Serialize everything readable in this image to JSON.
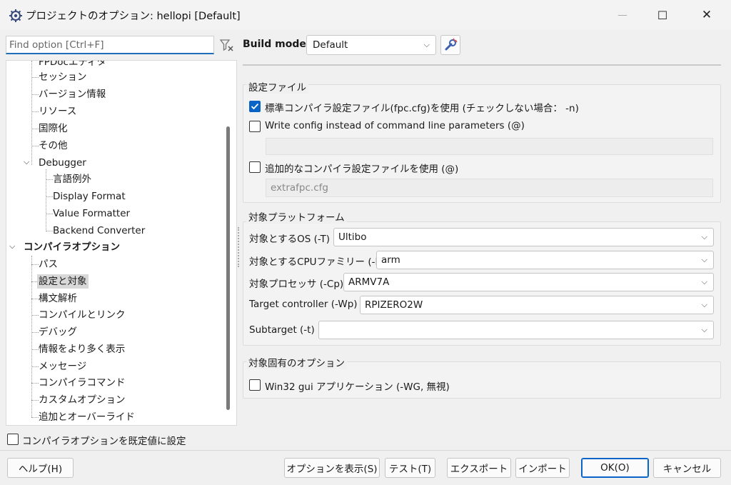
{
  "window": {
    "title": "プロジェクトのオプション: hellopi [Default]",
    "minimize": "—",
    "maximize": "☐",
    "close": "✕"
  },
  "search": {
    "placeholder": "Find option [Ctrl+F]"
  },
  "build_mode": {
    "label": "Build mode",
    "value": "Default"
  },
  "tree": {
    "items": [
      {
        "label": "FPDocエディタ"
      },
      {
        "label": "セッション"
      },
      {
        "label": "バージョン情報"
      },
      {
        "label": "リソース"
      },
      {
        "label": "国際化"
      },
      {
        "label": "その他"
      },
      {
        "label": "Debugger"
      },
      {
        "label": "言語例外"
      },
      {
        "label": "Display Format"
      },
      {
        "label": "Value Formatter"
      },
      {
        "label": "Backend Converter"
      },
      {
        "label": "コンパイラオプション"
      },
      {
        "label": "パス"
      },
      {
        "label": "設定と対象"
      },
      {
        "label": "構文解析"
      },
      {
        "label": "コンパイルとリンク"
      },
      {
        "label": "デバッグ"
      },
      {
        "label": "情報をより多く表示"
      },
      {
        "label": "メッセージ"
      },
      {
        "label": "コンパイラコマンド"
      },
      {
        "label": "カスタムオプション"
      },
      {
        "label": "追加とオーバーライド"
      }
    ],
    "expand_glyph": "⌵"
  },
  "config_files": {
    "group_label": "設定ファイル",
    "use_standard": {
      "label": "標準コンパイラ設定ファイル(fpc.cfg)を使用 (チェックしない場合： -n)",
      "checked": true
    },
    "write_config": {
      "label": "Write config instead of command line parameters (@)",
      "checked": false
    },
    "write_config_value": "",
    "use_additional": {
      "label": "追加的なコンパイラ設定ファイルを使用 (@)",
      "checked": false
    },
    "additional_value": "extrafpc.cfg"
  },
  "target_platform": {
    "group_label": "対象プラットフォーム",
    "os": {
      "label": "対象とするOS (-T)",
      "value": "Ultibo"
    },
    "cpu_family": {
      "label": "対象とするCPUファミリー (-P)",
      "value": "arm"
    },
    "processor": {
      "label": "対象プロセッサ (-Cp)",
      "value": "ARMV7A"
    },
    "controller": {
      "label": "Target controller (-Wp)",
      "value": "RPIZERO2W"
    },
    "subtarget": {
      "label": "Subtarget (-t)",
      "value": ""
    }
  },
  "target_specific": {
    "group_label": "対象固有のオプション",
    "win32_gui": {
      "label": "Win32 gui アプリケーション (-WG, 無視)",
      "checked": false
    }
  },
  "set_default": {
    "label": "コンパイラオプションを既定値に設定",
    "checked": false
  },
  "buttons": {
    "help": "ヘルプ(H)",
    "show_options": "オプションを表示(S)",
    "test": "テスト(T)",
    "export": "エクスポート",
    "import": "インポート",
    "ok": "OK(O)",
    "cancel": "キャンセル"
  },
  "colors": {
    "accent": "#0a64c8",
    "selection": "#d8d8d8"
  }
}
